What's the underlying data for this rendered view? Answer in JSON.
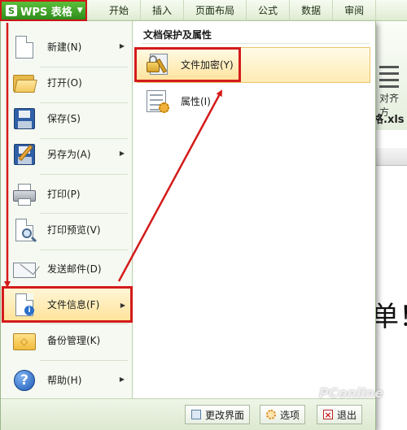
{
  "app": {
    "button_label": "WPS 表格",
    "logo": "S"
  },
  "ribbon": {
    "tabs": [
      "开始",
      "插入",
      "页面布局",
      "公式",
      "数据",
      "审阅"
    ],
    "align_label": "对齐方",
    "filename": "格.xls"
  },
  "menu": {
    "items": [
      {
        "label": "新建(N)",
        "icon": "new-doc-icon",
        "has_submenu": true
      },
      {
        "label": "打开(O)",
        "icon": "open-folder-icon",
        "has_submenu": false
      },
      {
        "label": "保存(S)",
        "icon": "save-disk-icon",
        "has_submenu": false
      },
      {
        "label": "另存为(A)",
        "icon": "save-as-icon",
        "has_submenu": true
      },
      {
        "label": "打印(P)",
        "icon": "printer-icon",
        "has_submenu": false
      },
      {
        "label": "打印预览(V)",
        "icon": "print-preview-icon",
        "has_submenu": false
      },
      {
        "label": "发送邮件(D)",
        "icon": "mail-icon",
        "has_submenu": false
      },
      {
        "label": "文件信息(F)",
        "icon": "file-info-icon",
        "has_submenu": true
      },
      {
        "label": "备份管理(K)",
        "icon": "backup-folder-icon",
        "has_submenu": false
      },
      {
        "label": "帮助(H)",
        "icon": "help-icon",
        "has_submenu": true
      }
    ],
    "active_item": "文件信息(F)"
  },
  "submenu": {
    "title": "文档保护及属性",
    "items": [
      {
        "label": "文件加密(Y)",
        "icon": "lock-key-icon"
      },
      {
        "label": "属性(I)",
        "icon": "properties-icon"
      }
    ],
    "active_item": "文件加密(Y)"
  },
  "bottom_bar": {
    "buttons": [
      {
        "label": "更改界面",
        "icon": "layout-icon"
      },
      {
        "label": "选项",
        "icon": "options-gear-icon"
      },
      {
        "label": "退出",
        "icon": "exit-icon"
      }
    ]
  },
  "document": {
    "visible_text": "单！"
  },
  "watermark": "PConline",
  "colors": {
    "highlight_border": "#d41b1b",
    "app_button": "#2f8d1c",
    "annotation_arrow": "#d41b1b"
  }
}
